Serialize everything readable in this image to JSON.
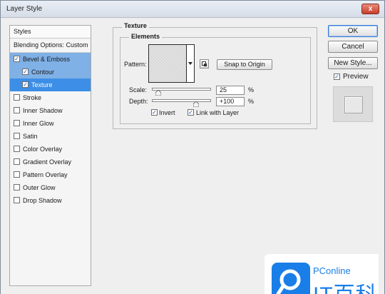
{
  "window": {
    "title": "Layer Style",
    "close": "x"
  },
  "styles_panel": {
    "header": "Styles",
    "blending": "Blending Options: Custom",
    "items": [
      {
        "label": "Bevel & Emboss",
        "checked": true
      },
      {
        "label": "Contour",
        "checked": true
      },
      {
        "label": "Texture",
        "checked": true
      },
      {
        "label": "Stroke",
        "checked": false
      },
      {
        "label": "Inner Shadow",
        "checked": false
      },
      {
        "label": "Inner Glow",
        "checked": false
      },
      {
        "label": "Satin",
        "checked": false
      },
      {
        "label": "Color Overlay",
        "checked": false
      },
      {
        "label": "Gradient Overlay",
        "checked": false
      },
      {
        "label": "Pattern Overlay",
        "checked": false
      },
      {
        "label": "Outer Glow",
        "checked": false
      },
      {
        "label": "Drop Shadow",
        "checked": false
      }
    ]
  },
  "texture": {
    "section_title": "Texture",
    "subsection_title": "Elements",
    "pattern_label": "Pattern:",
    "snap_button": "Snap to Origin",
    "scale_label": "Scale:",
    "scale_value": "25",
    "scale_unit": "%",
    "depth_label": "Depth:",
    "depth_value": "+100",
    "depth_unit": "%",
    "invert_label": "Invert",
    "invert_checked": true,
    "link_label": "Link with Layer",
    "link_checked": true
  },
  "buttons": {
    "ok": "OK",
    "cancel": "Cancel",
    "new_style": "New Style...",
    "preview_label": "Preview",
    "preview_checked": true
  },
  "watermark": {
    "brand_top": "PConline",
    "brand_big": "IT百科",
    "color": "#1a7ee8"
  },
  "check_mark": "✓"
}
